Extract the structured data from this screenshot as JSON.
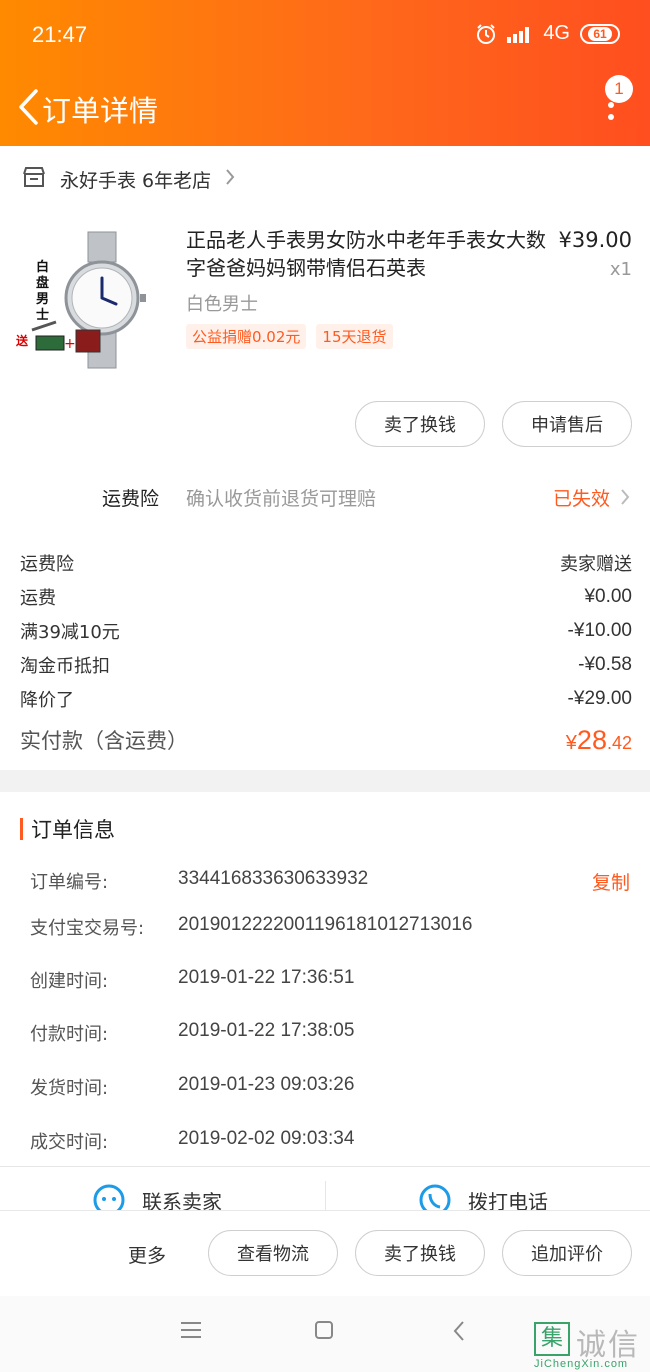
{
  "status": {
    "time": "21:47",
    "network": "4G",
    "battery": "61"
  },
  "header": {
    "title": "订单详情",
    "badge": "1"
  },
  "shop": {
    "name": "永好手表 6年老店"
  },
  "product": {
    "title": "正品老人手表男女防水中老年手表女大数字爸爸妈妈钢带情侣石英表",
    "price": "¥39.00",
    "qty": "x1",
    "sku": "白色男士",
    "tags": [
      "公益捐赠0.02元",
      "15天退货"
    ],
    "image_text": {
      "side": "白盘男士",
      "gift": "送"
    }
  },
  "product_actions": {
    "sell": "卖了换钱",
    "after_sale": "申请售后"
  },
  "insurance": {
    "label": "运费险",
    "desc": "确认收货前退货可理赔",
    "status": "已失效"
  },
  "fees": [
    {
      "label": "运费险",
      "value": "卖家赠送"
    },
    {
      "label": "运费",
      "value": "¥0.00"
    },
    {
      "label": "满39减10元",
      "value": "-¥10.00"
    },
    {
      "label": "淘金币抵扣",
      "value": "-¥0.58"
    },
    {
      "label": "降价了",
      "value": "-¥29.00"
    }
  ],
  "total": {
    "label": "实付款（含运费）",
    "currency": "¥",
    "integer": "28",
    "decimal": ".42"
  },
  "order_info": {
    "title": "订单信息",
    "copy": "复制",
    "rows": [
      {
        "label": "订单编号:",
        "value": "334416833630633932"
      },
      {
        "label": "支付宝交易号:",
        "value": "2019012222001196181012713016"
      },
      {
        "label": "创建时间:",
        "value": "2019-01-22 17:36:51"
      },
      {
        "label": "付款时间:",
        "value": "2019-01-22 17:38:05"
      },
      {
        "label": "发货时间:",
        "value": "2019-01-23 09:03:26"
      },
      {
        "label": "成交时间:",
        "value": "2019-02-02 09:03:34"
      }
    ]
  },
  "contact": {
    "seller": "联系卖家",
    "phone": "拨打电话"
  },
  "bottom": {
    "more": "更多",
    "logistics": "查看物流",
    "sell": "卖了换钱",
    "review": "追加评价"
  },
  "watermark": {
    "box": "集",
    "text": "诚信",
    "url": "JiChengXin.com"
  },
  "colors": {
    "accent": "#ff5a1f",
    "header_start": "#ff8a00",
    "header_end": "#ff4e1f"
  }
}
